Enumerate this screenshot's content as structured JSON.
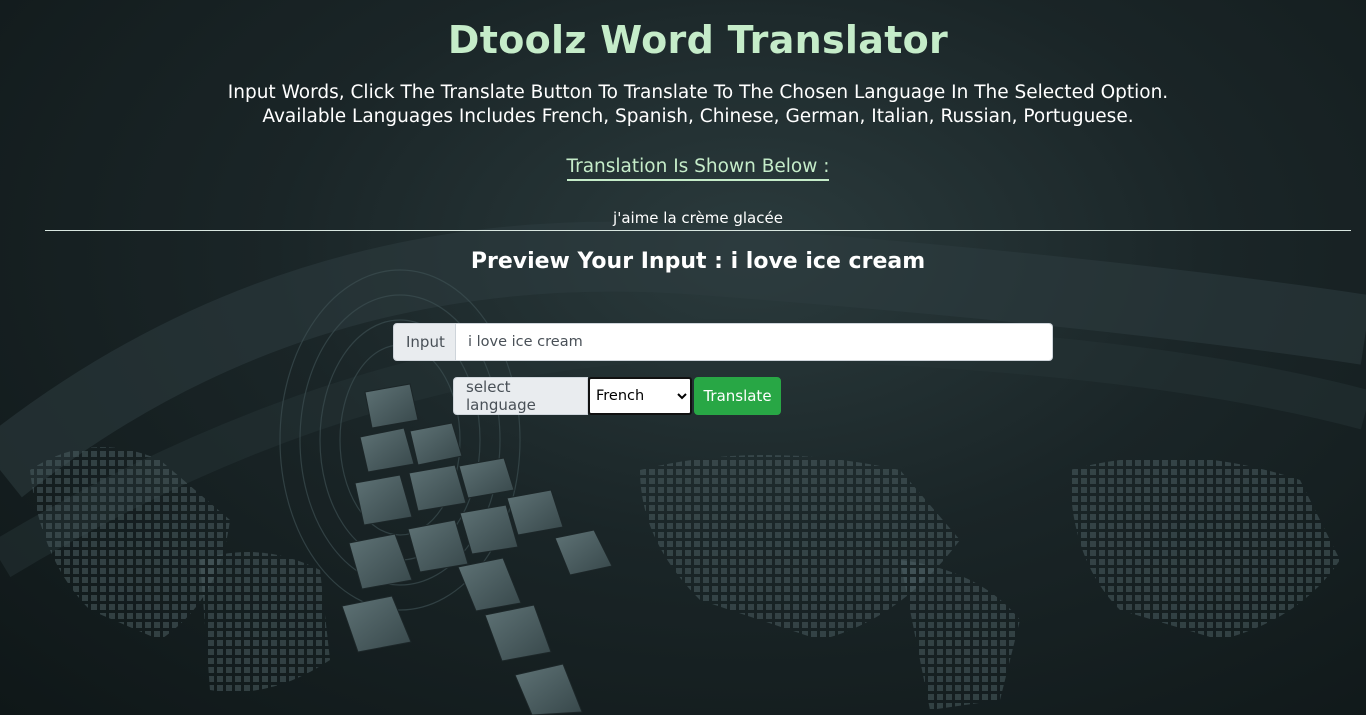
{
  "header": {
    "title": "Dtoolz Word Translator",
    "description_line1": "Input Words, Click The Translate Button To Translate To The Chosen Language In The Selected Option.",
    "description_line2": "Available Languages Includes French, Spanish, Chinese, German, Italian, Russian, Portuguese."
  },
  "result": {
    "label": "Translation Is Shown Below :",
    "translation": "j'aime la crème glacée"
  },
  "preview": {
    "text": "Preview Your Input : i love ice cream"
  },
  "input_group": {
    "addon_label": "Input",
    "value": "i love ice cream"
  },
  "language_group": {
    "addon_label": "select language",
    "selected": "French",
    "translate_button": "Translate"
  },
  "colors": {
    "heading_accent": "#c5ecc9",
    "button_green": "#28a745",
    "background": "#1a2527"
  }
}
